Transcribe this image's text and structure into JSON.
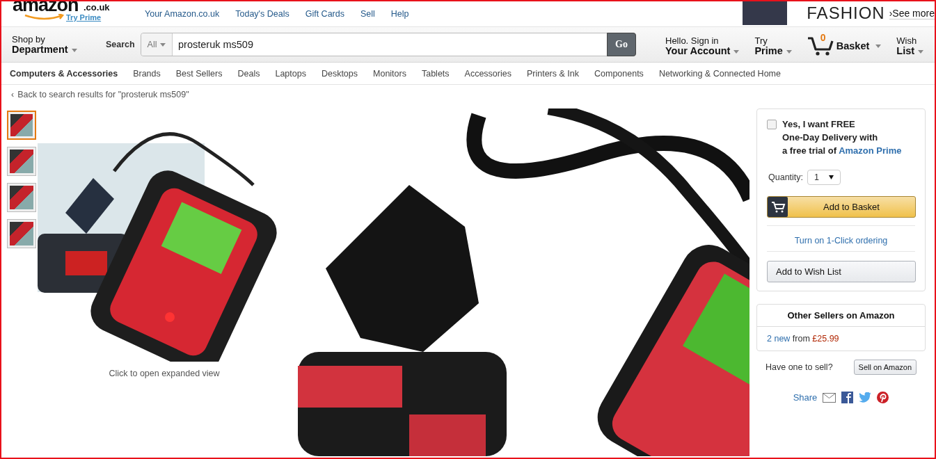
{
  "header": {
    "logo": {
      "wordmark": "amazon",
      "domain": ".co.uk",
      "try_prime": "Try Prime"
    },
    "top_links": [
      "Your Amazon.co.uk",
      "Today's Deals",
      "Gift Cards",
      "Sell",
      "Help"
    ],
    "ad": {
      "brand": "FASHION",
      "see_more": "›See more"
    }
  },
  "search_bar": {
    "shop_by": "Shop by",
    "department": "Department",
    "search_label": "Search",
    "category": "All",
    "query": "prosteruk ms509",
    "go": "Go"
  },
  "account_menu": [
    {
      "kind": "menu",
      "line1": "Hello. Sign in",
      "line2": "Your Account"
    },
    {
      "kind": "menu",
      "line1": "Try",
      "line2": "Prime"
    },
    {
      "kind": "basket",
      "line1": "0",
      "line2": "Basket"
    },
    {
      "kind": "menu",
      "line1": "Wish",
      "line2": "List"
    }
  ],
  "categories": [
    {
      "label": "Computers & Accessories",
      "selected": true
    },
    {
      "label": "Brands",
      "selected": false
    },
    {
      "label": "Best Sellers",
      "selected": false
    },
    {
      "label": "Deals",
      "selected": false
    },
    {
      "label": "Laptops",
      "selected": false
    },
    {
      "label": "Desktops",
      "selected": false
    },
    {
      "label": "Monitors",
      "selected": false
    },
    {
      "label": "Tablets",
      "selected": false
    },
    {
      "label": "Accessories",
      "selected": false
    },
    {
      "label": "Printers & Ink",
      "selected": false
    },
    {
      "label": "Components",
      "selected": false
    },
    {
      "label": "Networking & Connected Home",
      "selected": false
    }
  ],
  "breadcrumb": {
    "chevron": "‹",
    "text": "Back to search results for \"prosteruk ms509\""
  },
  "gallery": {
    "thumbnails": [
      {
        "selected": true
      },
      {
        "selected": false
      },
      {
        "selected": false
      },
      {
        "selected": false
      }
    ],
    "caption": "Click to open expanded view"
  },
  "buy_box": {
    "prime_offer": {
      "checked": false,
      "lines": [
        "Yes, I want FREE",
        "One-Day Delivery with",
        "a free trial of"
      ],
      "link": "Amazon Prime"
    },
    "quantity_label": "Quantity:",
    "quantity": "1",
    "add_to_basket": "Add to Basket",
    "one_click": "Turn on 1-Click ordering",
    "wish_list": "Add to Wish List"
  },
  "other_sellers": {
    "title": "Other Sellers on Amazon",
    "offer_link": "2 new",
    "from": "from",
    "price": "£25.99"
  },
  "sell": {
    "question": "Have one to sell?",
    "button": "Sell on Amazon"
  },
  "share": {
    "label": "Share"
  }
}
